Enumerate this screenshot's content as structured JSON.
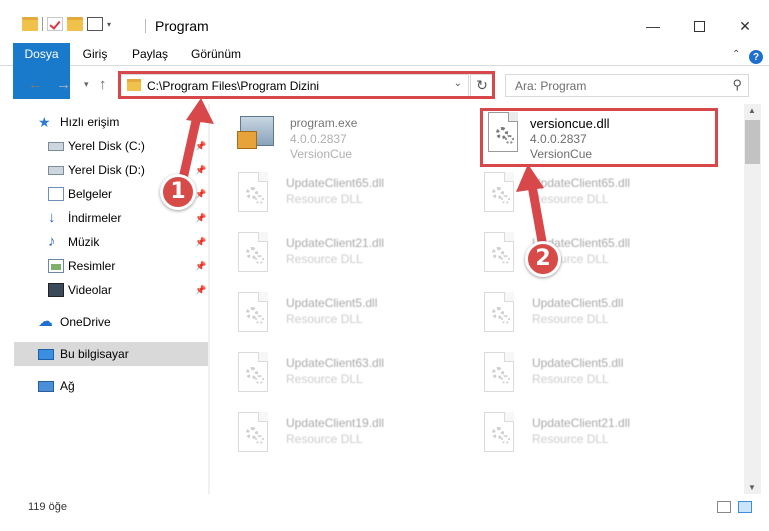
{
  "window": {
    "title": "Program",
    "minimize_glyph": "—",
    "close_glyph": "✕"
  },
  "ribbon": {
    "tabs": [
      "Dosya",
      "Giriş",
      "Paylaş",
      "Görünüm"
    ],
    "help_glyph": "?",
    "collapse_glyph": "⌃"
  },
  "navigation": {
    "back_glyph": "←",
    "forward_glyph": "→",
    "recent_glyph": "▾",
    "up_glyph": "↑",
    "address": "C:\\Program Files\\Program Dizini",
    "address_dropdown_glyph": "⌄",
    "refresh_glyph": "↻",
    "search_placeholder": "Ara: Program",
    "search_glyph": "⚲"
  },
  "sidebar": {
    "items": [
      {
        "label": "Hızlı erişim",
        "icon": "star-icon",
        "pinned": false
      },
      {
        "label": "Yerel Disk (C:)",
        "icon": "drive-icon",
        "pinned": true
      },
      {
        "label": "Yerel Disk (D:)",
        "icon": "drive-icon",
        "pinned": true
      },
      {
        "label": "Belgeler",
        "icon": "documents-icon",
        "pinned": true
      },
      {
        "label": "İndirmeler",
        "icon": "download-icon",
        "pinned": true
      },
      {
        "label": "Müzik",
        "icon": "music-icon",
        "pinned": true
      },
      {
        "label": "Resimler",
        "icon": "pictures-icon",
        "pinned": true
      },
      {
        "label": "Videolar",
        "icon": "videos-icon",
        "pinned": true
      },
      {
        "label": "OneDrive",
        "icon": "cloud-icon",
        "pinned": false
      },
      {
        "label": "Bu bilgisayar",
        "icon": "computer-icon",
        "pinned": false,
        "selected": true
      },
      {
        "label": "Ağ",
        "icon": "network-icon",
        "pinned": false
      }
    ],
    "pin_glyph": "📌"
  },
  "files": {
    "col1": [
      {
        "name": "program.exe",
        "line1": "4.0.0.2837",
        "line2": "VersionCue",
        "type": "exe"
      },
      {
        "name": "UpdateClient65.dll",
        "line1": "Resource DLL",
        "type": "dll"
      },
      {
        "name": "UpdateClient21.dll",
        "line1": "Resource DLL",
        "type": "dll"
      },
      {
        "name": "UpdateClient5.dll",
        "line1": "Resource DLL",
        "type": "dll"
      },
      {
        "name": "UpdateClient63.dll",
        "line1": "Resource DLL",
        "type": "dll"
      },
      {
        "name": "UpdateClient19.dll",
        "line1": "Resource DLL",
        "type": "dll"
      }
    ],
    "col2": [
      {
        "name": "versioncue.dll",
        "line1": "4.0.0.2837",
        "line2": "VersionCue",
        "type": "dll",
        "highlight": true
      },
      {
        "name": "UpdateClient65.dll",
        "line1": "Resource DLL",
        "type": "dll"
      },
      {
        "name": "UpdateClient65.dll",
        "line1": "Resource DLL",
        "type": "dll"
      },
      {
        "name": "UpdateClient5.dll",
        "line1": "Resource DLL",
        "type": "dll"
      },
      {
        "name": "UpdateClient5.dll",
        "line1": "Resource DLL",
        "type": "dll"
      },
      {
        "name": "UpdateClient21.dll",
        "line1": "Resource DLL",
        "type": "dll"
      }
    ]
  },
  "status": {
    "item_count": "119 öğe"
  },
  "callouts": {
    "step1": "1",
    "step2": "2",
    "accent_color": "#d8474a"
  },
  "scrollbar": {
    "up_glyph": "▲",
    "down_glyph": "▼"
  }
}
